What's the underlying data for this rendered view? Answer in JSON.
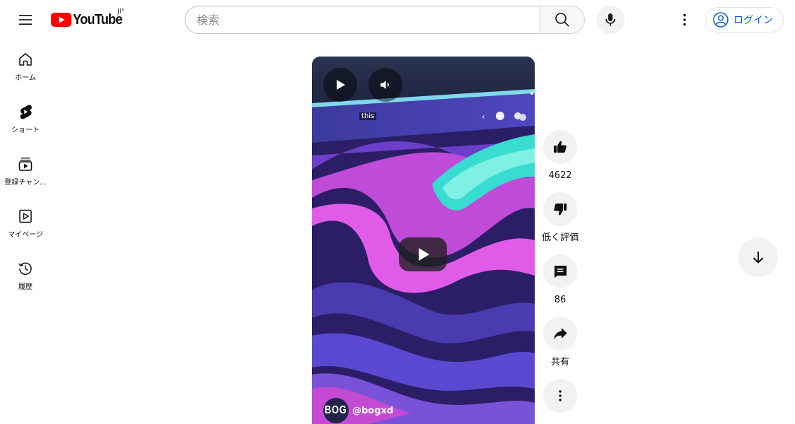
{
  "masthead": {
    "logo_text": "YouTube",
    "country_code": "JP",
    "search_placeholder": "検索",
    "login_label": "ログイン"
  },
  "guide": {
    "items": [
      {
        "label": "ホーム",
        "icon": "home-icon"
      },
      {
        "label": "ショート",
        "icon": "shorts-icon"
      },
      {
        "label": "登録チャン...",
        "icon": "subscriptions-icon"
      },
      {
        "label": "マイページ",
        "icon": "you-icon"
      },
      {
        "label": "履歴",
        "icon": "history-icon"
      }
    ]
  },
  "player": {
    "caption": "this",
    "channel_avatar_text": "BOG",
    "channel_handle": "@bogxd"
  },
  "actions": {
    "like_count": "4622",
    "dislike_label": "低く評価",
    "comment_count": "86",
    "share_label": "共有"
  },
  "colors": {
    "brand_red": "#ff0000",
    "link_blue": "#065fd4",
    "button_bg": "#f2f2f2"
  }
}
